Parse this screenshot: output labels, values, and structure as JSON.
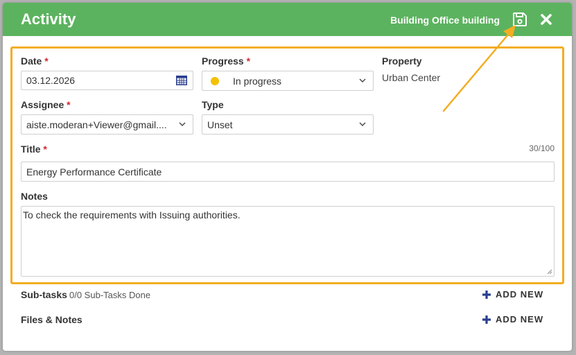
{
  "header": {
    "title": "Activity",
    "context_prefix": "Building",
    "context_name": "Office building"
  },
  "form": {
    "date": {
      "label": "Date",
      "required": "*",
      "value": "03.12.2026"
    },
    "progress": {
      "label": "Progress",
      "required": "*",
      "value": "In progress",
      "status_color": "#f5c000"
    },
    "property": {
      "label": "Property",
      "value": "Urban Center"
    },
    "assignee": {
      "label": "Assignee",
      "required": "*",
      "value": "aiste.moderan+Viewer@gmail...."
    },
    "type": {
      "label": "Type",
      "value": "Unset"
    },
    "title": {
      "label": "Title",
      "required": "*",
      "counter": "30/100",
      "value": "Energy Performance Certificate"
    },
    "notes": {
      "label": "Notes",
      "value": "To check the requirements with Issuing authorities."
    }
  },
  "subtasks": {
    "label": "Sub-tasks",
    "status": "0/0 Sub-Tasks Done",
    "add_label": "ADD NEW"
  },
  "files": {
    "label": "Files & Notes",
    "add_label": "ADD NEW"
  },
  "colors": {
    "header": "#5cb35f",
    "highlight": "#f3ad22",
    "required": "#d0262d",
    "accent": "#2a3f8f"
  },
  "icons": {
    "save": "floppy-disk-icon",
    "close": "close-x-icon",
    "calendar": "calendar-icon",
    "chevron": "chevron-down-icon",
    "plus": "plus-icon"
  }
}
